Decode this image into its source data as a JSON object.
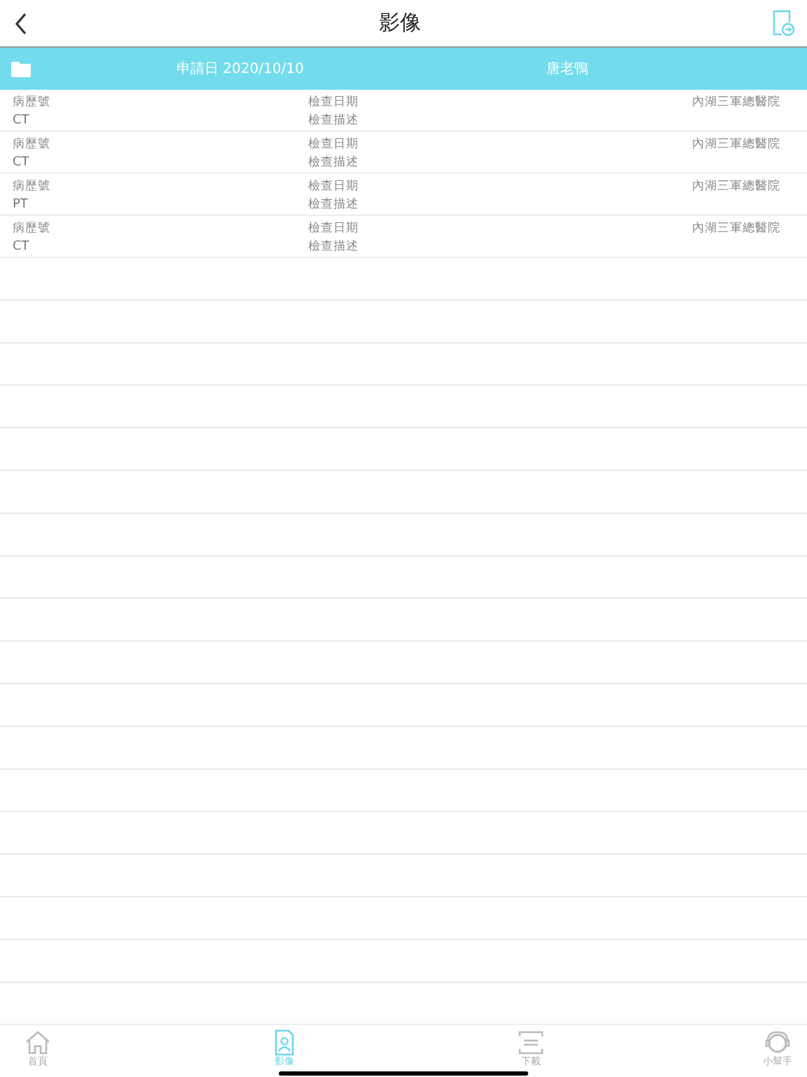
{
  "nav_bar": {
    "title": "影像"
  },
  "group_header": {
    "date": "申請日 2020/10/10",
    "name": "唐老鴨"
  },
  "records": [
    {
      "chart_no": "病歷號",
      "date": "檢查日期",
      "hospital": "內湖三軍總醫院",
      "modality": "CT",
      "description": "檢查描述"
    },
    {
      "chart_no": "病歷號",
      "date": "檢查日期",
      "hospital": "內湖三軍總醫院",
      "modality": "CT",
      "description": "檢查描述"
    },
    {
      "chart_no": "病歷號",
      "date": "檢查日期",
      "hospital": "內湖三軍總醫院",
      "modality": "PT",
      "description": "檢查描述"
    },
    {
      "chart_no": "病歷號",
      "date": "檢查日期",
      "hospital": "內湖三軍總醫院",
      "modality": "CT",
      "description": "檢查描述"
    }
  ],
  "tab_bar": [
    {
      "kind": "home",
      "label": "首頁",
      "selected": false
    },
    {
      "kind": "image",
      "label": "影像",
      "selected": true
    },
    {
      "kind": "download",
      "label": "下載",
      "selected": false
    },
    {
      "kind": "helper",
      "label": "小幫手",
      "selected": false
    }
  ]
}
